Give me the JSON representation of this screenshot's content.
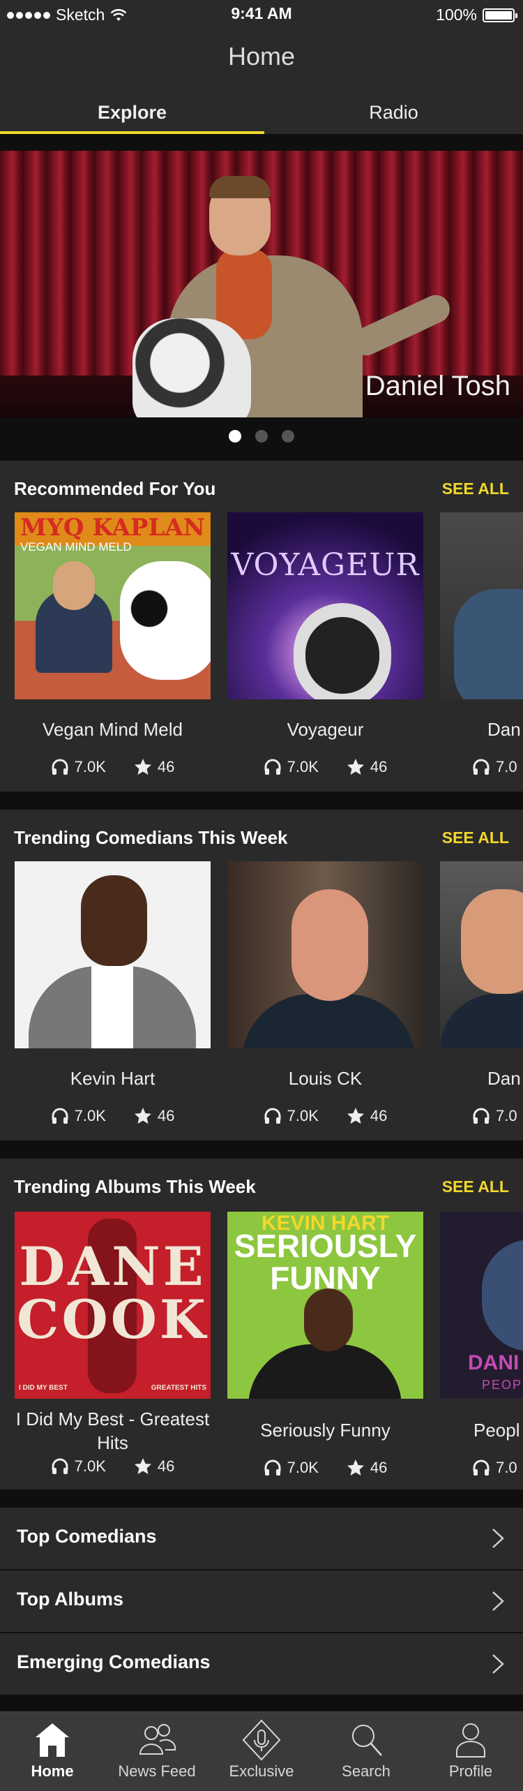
{
  "status_bar": {
    "carrier": "Sketch",
    "time": "9:41 AM",
    "battery": "100%"
  },
  "nav": {
    "title": "Home"
  },
  "tabs": [
    {
      "label": "Explore",
      "active": true
    },
    {
      "label": "Radio",
      "active": false
    }
  ],
  "hero": {
    "name": "Daniel Tosh",
    "pages": 3,
    "current_page": 1
  },
  "sections": [
    {
      "title": "Recommended For You",
      "see_all": "SEE ALL",
      "items": [
        {
          "title": "Vegan Mind Meld",
          "plays": "7.0K",
          "stars": "46",
          "art_text_1": "MYQ KAPLAN",
          "art_text_2": "VEGAN MIND MELD"
        },
        {
          "title": "Voyageur",
          "plays": "7.0K",
          "stars": "46",
          "art_text_1": "VOYAGEUR"
        },
        {
          "title": "Dan",
          "plays": "7.0",
          "stars": ""
        }
      ]
    },
    {
      "title": "Trending Comedians This Week",
      "see_all": "SEE ALL",
      "items": [
        {
          "title": "Kevin Hart",
          "plays": "7.0K",
          "stars": "46"
        },
        {
          "title": "Louis CK",
          "plays": "7.0K",
          "stars": "46"
        },
        {
          "title": "Dan",
          "plays": "7.0",
          "stars": ""
        }
      ]
    },
    {
      "title": "Trending Albums This Week",
      "see_all": "SEE ALL",
      "items": [
        {
          "title": "I Did My Best - Greatest Hits",
          "plays": "7.0K",
          "stars": "46",
          "art_text_1": "DANE",
          "art_text_2": "COOK",
          "art_text_3": "I DID MY BEST",
          "art_text_4": "GREATEST HITS"
        },
        {
          "title": "Seriously Funny",
          "plays": "7.0K",
          "stars": "46",
          "art_text_1": "KEVIN HART",
          "art_text_2": "SERIOUSLY",
          "art_text_3": "FUNNY"
        },
        {
          "title": "Peopl",
          "plays": "7.0",
          "stars": "",
          "art_text_1": "DANI",
          "art_text_2": "PEOPL"
        }
      ]
    }
  ],
  "list_rows": [
    {
      "label": "Top Comedians"
    },
    {
      "label": "Top Albums"
    },
    {
      "label": "Emerging Comedians"
    }
  ],
  "tab_bar": [
    {
      "label": "Home",
      "icon": "home-icon",
      "active": true
    },
    {
      "label": "News Feed",
      "icon": "people-icon",
      "active": false
    },
    {
      "label": "Exclusive",
      "icon": "microphone-diamond-icon",
      "active": false
    },
    {
      "label": "Search",
      "icon": "search-icon",
      "active": false
    },
    {
      "label": "Profile",
      "icon": "person-icon",
      "active": false
    }
  ],
  "colors": {
    "accent": "#f2d82a",
    "background": "#0f0f0f",
    "surface": "#2a2a2a",
    "tab_bar": "#3a3a3a"
  }
}
